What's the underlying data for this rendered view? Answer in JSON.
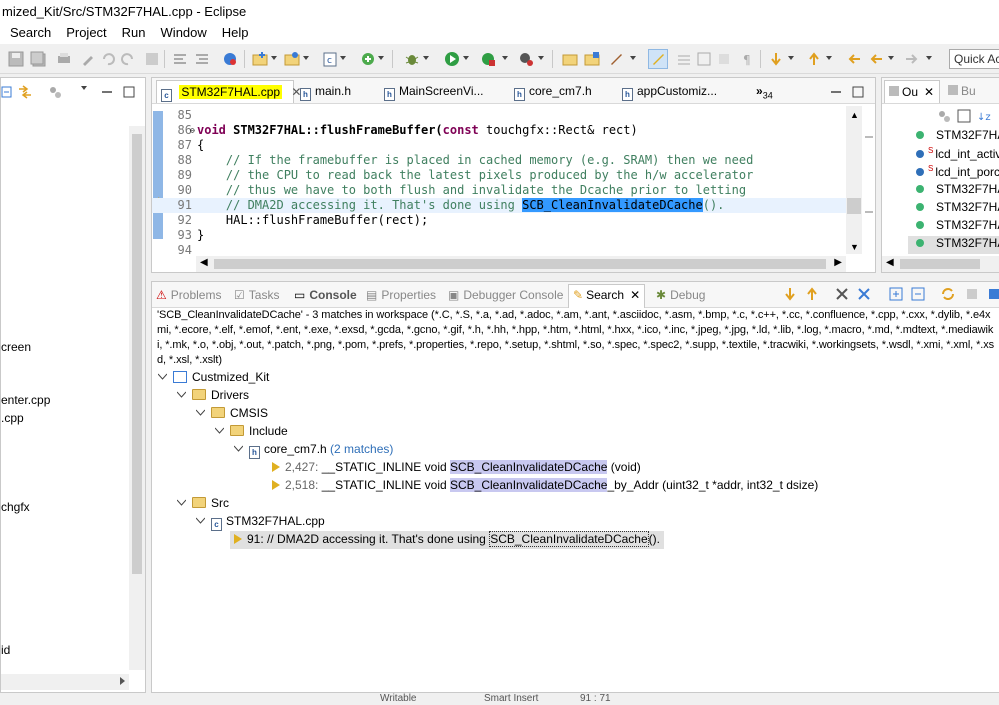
{
  "window": {
    "title": "mized_Kit/Src/STM32F7HAL.cpp - Eclipse"
  },
  "menu": [
    "Search",
    "Project",
    "Run",
    "Window",
    "Help"
  ],
  "toolbar": {
    "quick_access": "Quick Ac"
  },
  "left_panel": {
    "items": [
      "creen",
      "enter.cpp",
      ".cpp",
      "chgfx",
      "id"
    ]
  },
  "editor": {
    "tabs": [
      {
        "label": "STM32F7HAL.cpp",
        "active": true
      },
      {
        "label": "main.h"
      },
      {
        "label": "MainScreenVi..."
      },
      {
        "label": "core_cm7.h"
      },
      {
        "label": "appCustomiz..."
      }
    ],
    "overflow_count": "34",
    "lines": [
      {
        "n": "85",
        "t": ""
      },
      {
        "n": "86",
        "pre": "void",
        "mid": " STM32F7HAL::flushFrameBuffer(",
        "kw2": "const",
        "post": " touchgfx::Rect& rect)"
      },
      {
        "n": "87",
        "t": "{"
      },
      {
        "n": "88",
        "c": "    // If the framebuffer is placed in cached memory (e.g. SRAM) then we need"
      },
      {
        "n": "89",
        "c": "    // the CPU to read back the latest pixels produced by the h/w accelerator"
      },
      {
        "n": "90",
        "c": "    // thus we have to both flush and invalidate the Dcache prior to letting"
      },
      {
        "n": "91",
        "c": "    // DMA2D accessing it. That's done using ",
        "s": "SCB_CleanInvalidateDCache",
        "e": "()."
      },
      {
        "n": "92",
        "t": "    HAL::flushFrameBuffer(rect);"
      },
      {
        "n": "93",
        "t": "}"
      },
      {
        "n": "94",
        "t": ""
      }
    ]
  },
  "outline": {
    "tab": "Ou",
    "tab2": "Bu",
    "items": [
      "STM32F7HA",
      "lcd_int_activ",
      "lcd_int_porc",
      "STM32F7HA",
      "STM32F7HA",
      "STM32F7HA",
      "STM32F7HA"
    ]
  },
  "bottom": {
    "tabs": [
      "Problems",
      "Tasks",
      "Console",
      "Properties",
      "Debugger Console",
      "Search",
      "Debug"
    ],
    "summary": "'SCB_CleanInvalidateDCache' - 3 matches in workspace (*.C, *.S, *.a, *.ad, *.adoc, *.am, *.ant, *.asciidoc, *.asm, *.bmp, *.c, *.c++, *.cc, *.confluence, *.cpp, *.cxx, *.dylib, *.e4xmi, *.ecore, *.elf, *.emof, *.ent, *.exe, *.exsd, *.gcda, *.gcno, *.gif, *.h, *.hh, *.hpp, *.htm, *.html, *.hxx, *.ico, *.inc, *.jpeg, *.jpg, *.ld, *.lib, *.log, *.macro, *.md, *.mdtext, *.mediawiki, *.mk, *.o, *.obj, *.out, *.patch, *.png, *.pom, *.prefs, *.properties, *.repo, *.setup, *.shtml, *.so, *.spec, *.spec2, *.supp, *.textile, *.tracwiki, *.workingsets, *.wsdl, *.xmi, *.xml, *.xsd, *.xsl, *.xslt)",
    "tree": {
      "project": "Custmized_Kit",
      "drivers": "Drivers",
      "cmsis": "CMSIS",
      "include": "Include",
      "file1": "core_cm7.h",
      "file1_count": "(2 matches)",
      "m1_line": "2,427:",
      "m1_pre": "__STATIC_INLINE void",
      "m1_hl": "SCB_CleanInvalidateDCache",
      "m1_post": "(void)",
      "m2_line": "2,518:",
      "m2_pre": "__STATIC_INLINE void",
      "m2_hl": "SCB_CleanInvalidateDCache",
      "m2_post": "_by_Addr (uint32_t *addr, int32_t dsize)",
      "src": "Src",
      "file2": "STM32F7HAL.cpp",
      "m3_pre": "91: // DMA2D accessing it. That's done using",
      "m3_hl": "SCB_CleanInvalidateDCache",
      "m3_post": "()."
    }
  },
  "status": {
    "a": "Writable",
    "b": "Smart Insert",
    "c": "91 : 71"
  },
  "colors": {
    "highlight_yellow": "#ffff00",
    "selection_blue": "#3399ff",
    "match_highlight": "#c8c8f0"
  }
}
